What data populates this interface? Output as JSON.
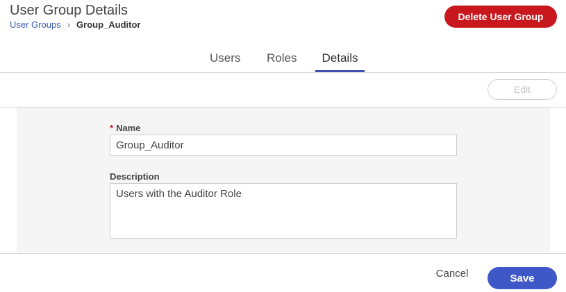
{
  "header": {
    "title": "User Group Details",
    "breadcrumb": {
      "parent": "User Groups",
      "separator": "›",
      "current": "Group_Auditor"
    },
    "delete_label": "Delete User Group"
  },
  "tabs": [
    {
      "label": "Users",
      "active": false
    },
    {
      "label": "Roles",
      "active": false
    },
    {
      "label": "Details",
      "active": true
    }
  ],
  "toolbar": {
    "edit_label": "Edit"
  },
  "form": {
    "name": {
      "required_mark": "*",
      "label": "Name",
      "value": "Group_Auditor"
    },
    "description": {
      "label": "Description",
      "value": "Users with the Auditor Role"
    }
  },
  "footer": {
    "cancel_label": "Cancel",
    "save_label": "Save"
  },
  "colors": {
    "danger": "#c8181e",
    "primary": "#3f58c8",
    "link": "#3b5bb5",
    "tab_indicator": "#3f51b5",
    "panel_bg": "#f5f5f5"
  }
}
